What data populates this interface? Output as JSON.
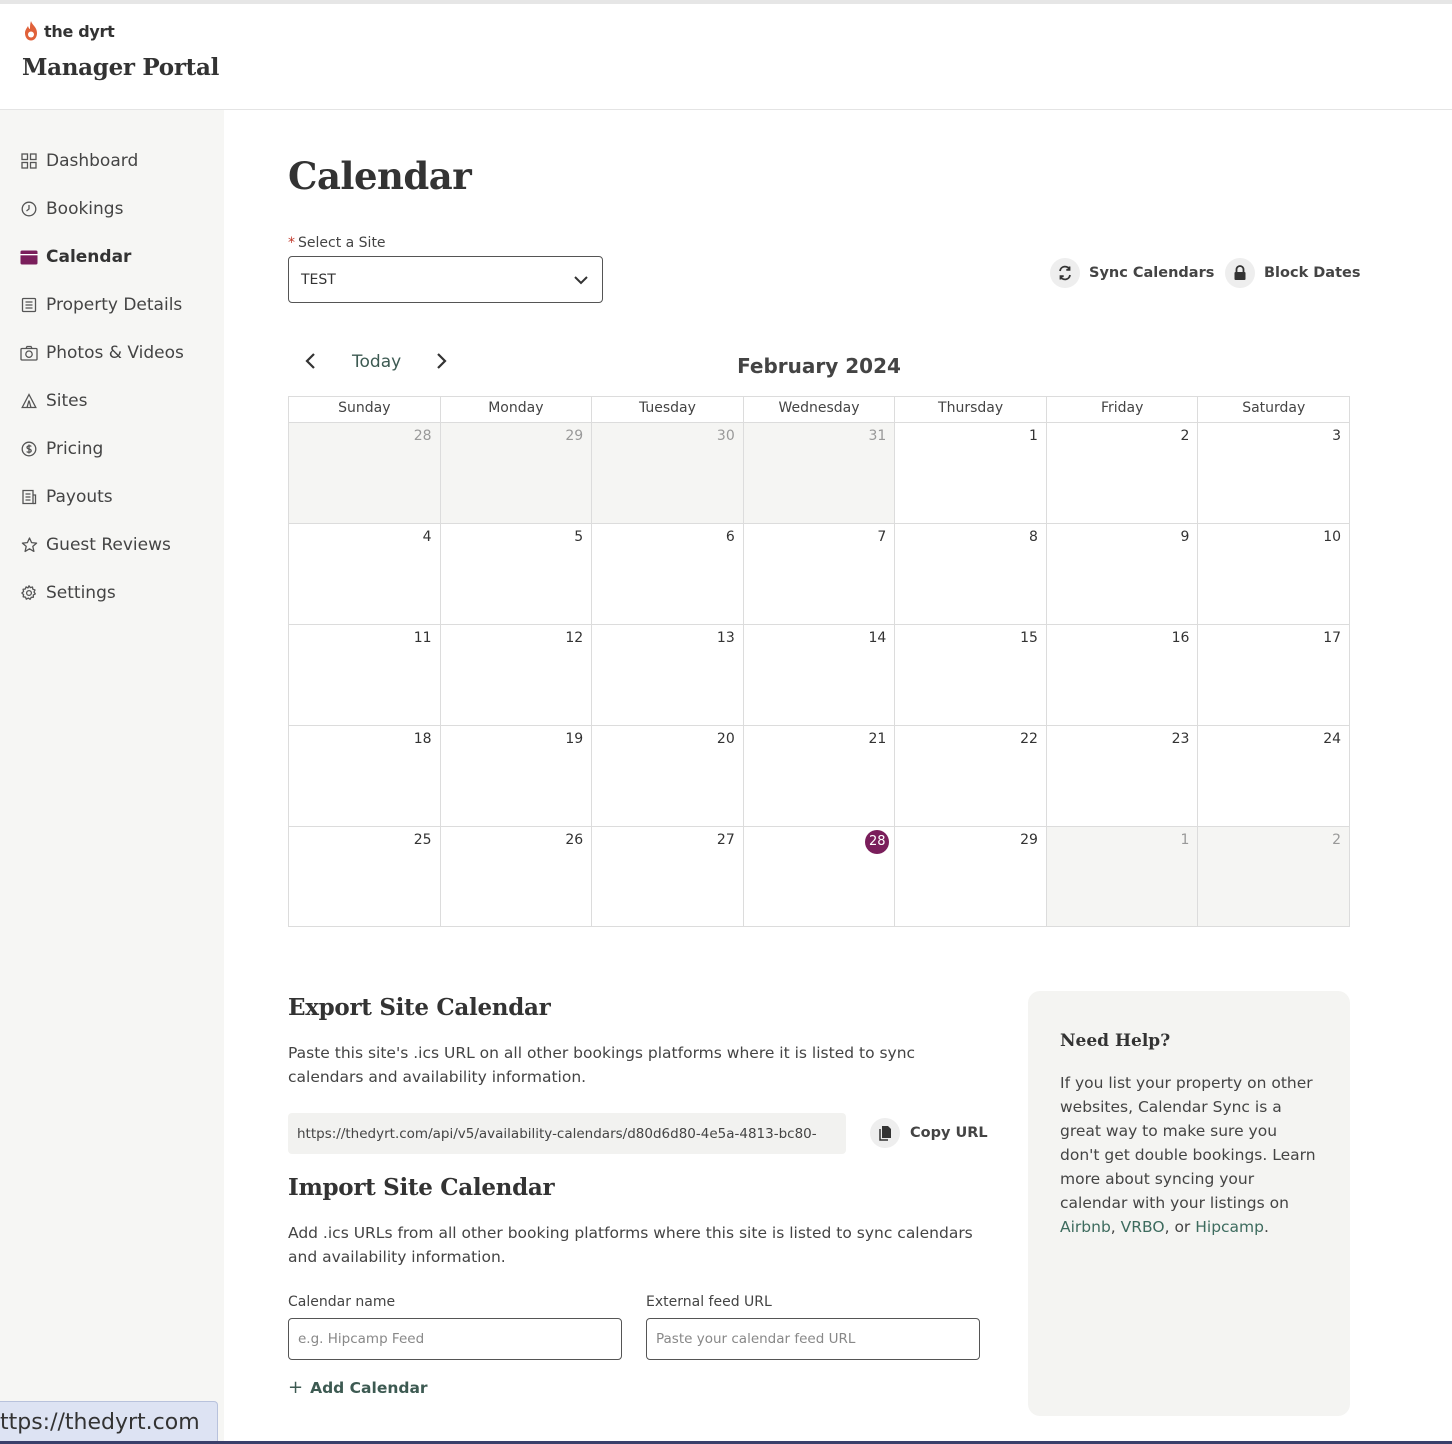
{
  "header": {
    "logo_text": "the dyrt",
    "portal_title": "Manager Portal"
  },
  "sidebar": {
    "items": [
      {
        "label": "Dashboard",
        "icon": "grid-icon",
        "active": false
      },
      {
        "label": "Bookings",
        "icon": "clock-icon",
        "active": false
      },
      {
        "label": "Calendar",
        "icon": "calendar-icon",
        "active": true
      },
      {
        "label": "Property Details",
        "icon": "document-icon",
        "active": false
      },
      {
        "label": "Photos & Videos",
        "icon": "camera-icon",
        "active": false
      },
      {
        "label": "Sites",
        "icon": "tent-icon",
        "active": false
      },
      {
        "label": "Pricing",
        "icon": "dollar-icon",
        "active": false
      },
      {
        "label": "Payouts",
        "icon": "receipt-icon",
        "active": false
      },
      {
        "label": "Guest Reviews",
        "icon": "star-icon",
        "active": false
      },
      {
        "label": "Settings",
        "icon": "gear-icon",
        "active": false
      }
    ]
  },
  "main": {
    "page_title": "Calendar",
    "site_select": {
      "required_mark": "*",
      "label": "Select a Site",
      "value": "TEST"
    },
    "actions": {
      "sync_label": "Sync Calendars",
      "block_label": "Block Dates"
    },
    "calendar": {
      "today_label": "Today",
      "month_title": "February 2024",
      "weekdays": [
        "Sunday",
        "Monday",
        "Tuesday",
        "Wednesday",
        "Thursday",
        "Friday",
        "Saturday"
      ],
      "weeks": [
        [
          {
            "d": "28",
            "other": true
          },
          {
            "d": "29",
            "other": true
          },
          {
            "d": "30",
            "other": true
          },
          {
            "d": "31",
            "other": true
          },
          {
            "d": "1"
          },
          {
            "d": "2"
          },
          {
            "d": "3"
          }
        ],
        [
          {
            "d": "4"
          },
          {
            "d": "5"
          },
          {
            "d": "6"
          },
          {
            "d": "7"
          },
          {
            "d": "8"
          },
          {
            "d": "9"
          },
          {
            "d": "10"
          }
        ],
        [
          {
            "d": "11"
          },
          {
            "d": "12"
          },
          {
            "d": "13"
          },
          {
            "d": "14"
          },
          {
            "d": "15"
          },
          {
            "d": "16"
          },
          {
            "d": "17"
          }
        ],
        [
          {
            "d": "18"
          },
          {
            "d": "19"
          },
          {
            "d": "20"
          },
          {
            "d": "21"
          },
          {
            "d": "22"
          },
          {
            "d": "23"
          },
          {
            "d": "24"
          }
        ],
        [
          {
            "d": "25"
          },
          {
            "d": "26"
          },
          {
            "d": "27"
          },
          {
            "d": "28",
            "today": true
          },
          {
            "d": "29"
          },
          {
            "d": "1",
            "other": true
          },
          {
            "d": "2",
            "other": true
          }
        ]
      ],
      "today_color": "#7a1e5b"
    },
    "export": {
      "title": "Export Site Calendar",
      "description": "Paste this site's .ics URL on all other bookings platforms where it is listed to sync calendars and availability information.",
      "url": "https://thedyrt.com/api/v5/availability-calendars/d80d6d80-4e5a-4813-bc80-",
      "copy_label": "Copy URL"
    },
    "import": {
      "title": "Import Site Calendar",
      "description": "Add .ics URLs from all other booking platforms where this site is listed to sync calendars and availability information.",
      "name_label": "Calendar name",
      "name_placeholder": "e.g. Hipcamp Feed",
      "feed_label": "External feed URL",
      "feed_placeholder": "Paste your calendar feed URL",
      "add_label": "Add Calendar"
    },
    "help": {
      "title": "Need Help?",
      "text": "If you list your property on other websites, Calendar Sync is a great way to make sure you don't get double bookings. Learn more about syncing your calendar with your listings on",
      "link_airbnb": "Airbnb",
      "link_vrbo": "VRBO",
      "link_hipcamp": "Hipcamp",
      "sep1": ", ",
      "sep2": ", or ",
      "end": "."
    }
  },
  "status_bar": {
    "url": "ttps://thedyrt.com"
  }
}
